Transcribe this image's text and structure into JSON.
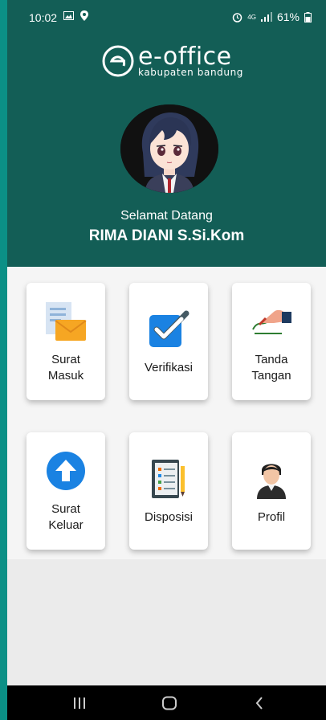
{
  "status_bar": {
    "time": "10:02",
    "battery": "61%",
    "network": "4G"
  },
  "app": {
    "logo_title": "e-office",
    "logo_subtitle": "kabupaten bandung",
    "brand_color": "#135e56"
  },
  "profile": {
    "welcome": "Selamat Datang",
    "name": "RIMA DIANI S.Si.Kom"
  },
  "menu": [
    {
      "label": "Surat\nMasuk",
      "icon": "mail-document-icon"
    },
    {
      "label": "Verifikasi",
      "icon": "checkbox-icon"
    },
    {
      "label": "Tanda\nTangan",
      "icon": "signature-hand-icon"
    },
    {
      "label": "Surat\nKeluar",
      "icon": "upload-arrow-icon"
    },
    {
      "label": "Disposisi",
      "icon": "notebook-icon"
    },
    {
      "label": "Profil",
      "icon": "user-icon"
    }
  ],
  "navbar": {
    "recent": "recent-apps-icon",
    "home": "home-icon",
    "back": "back-icon"
  }
}
